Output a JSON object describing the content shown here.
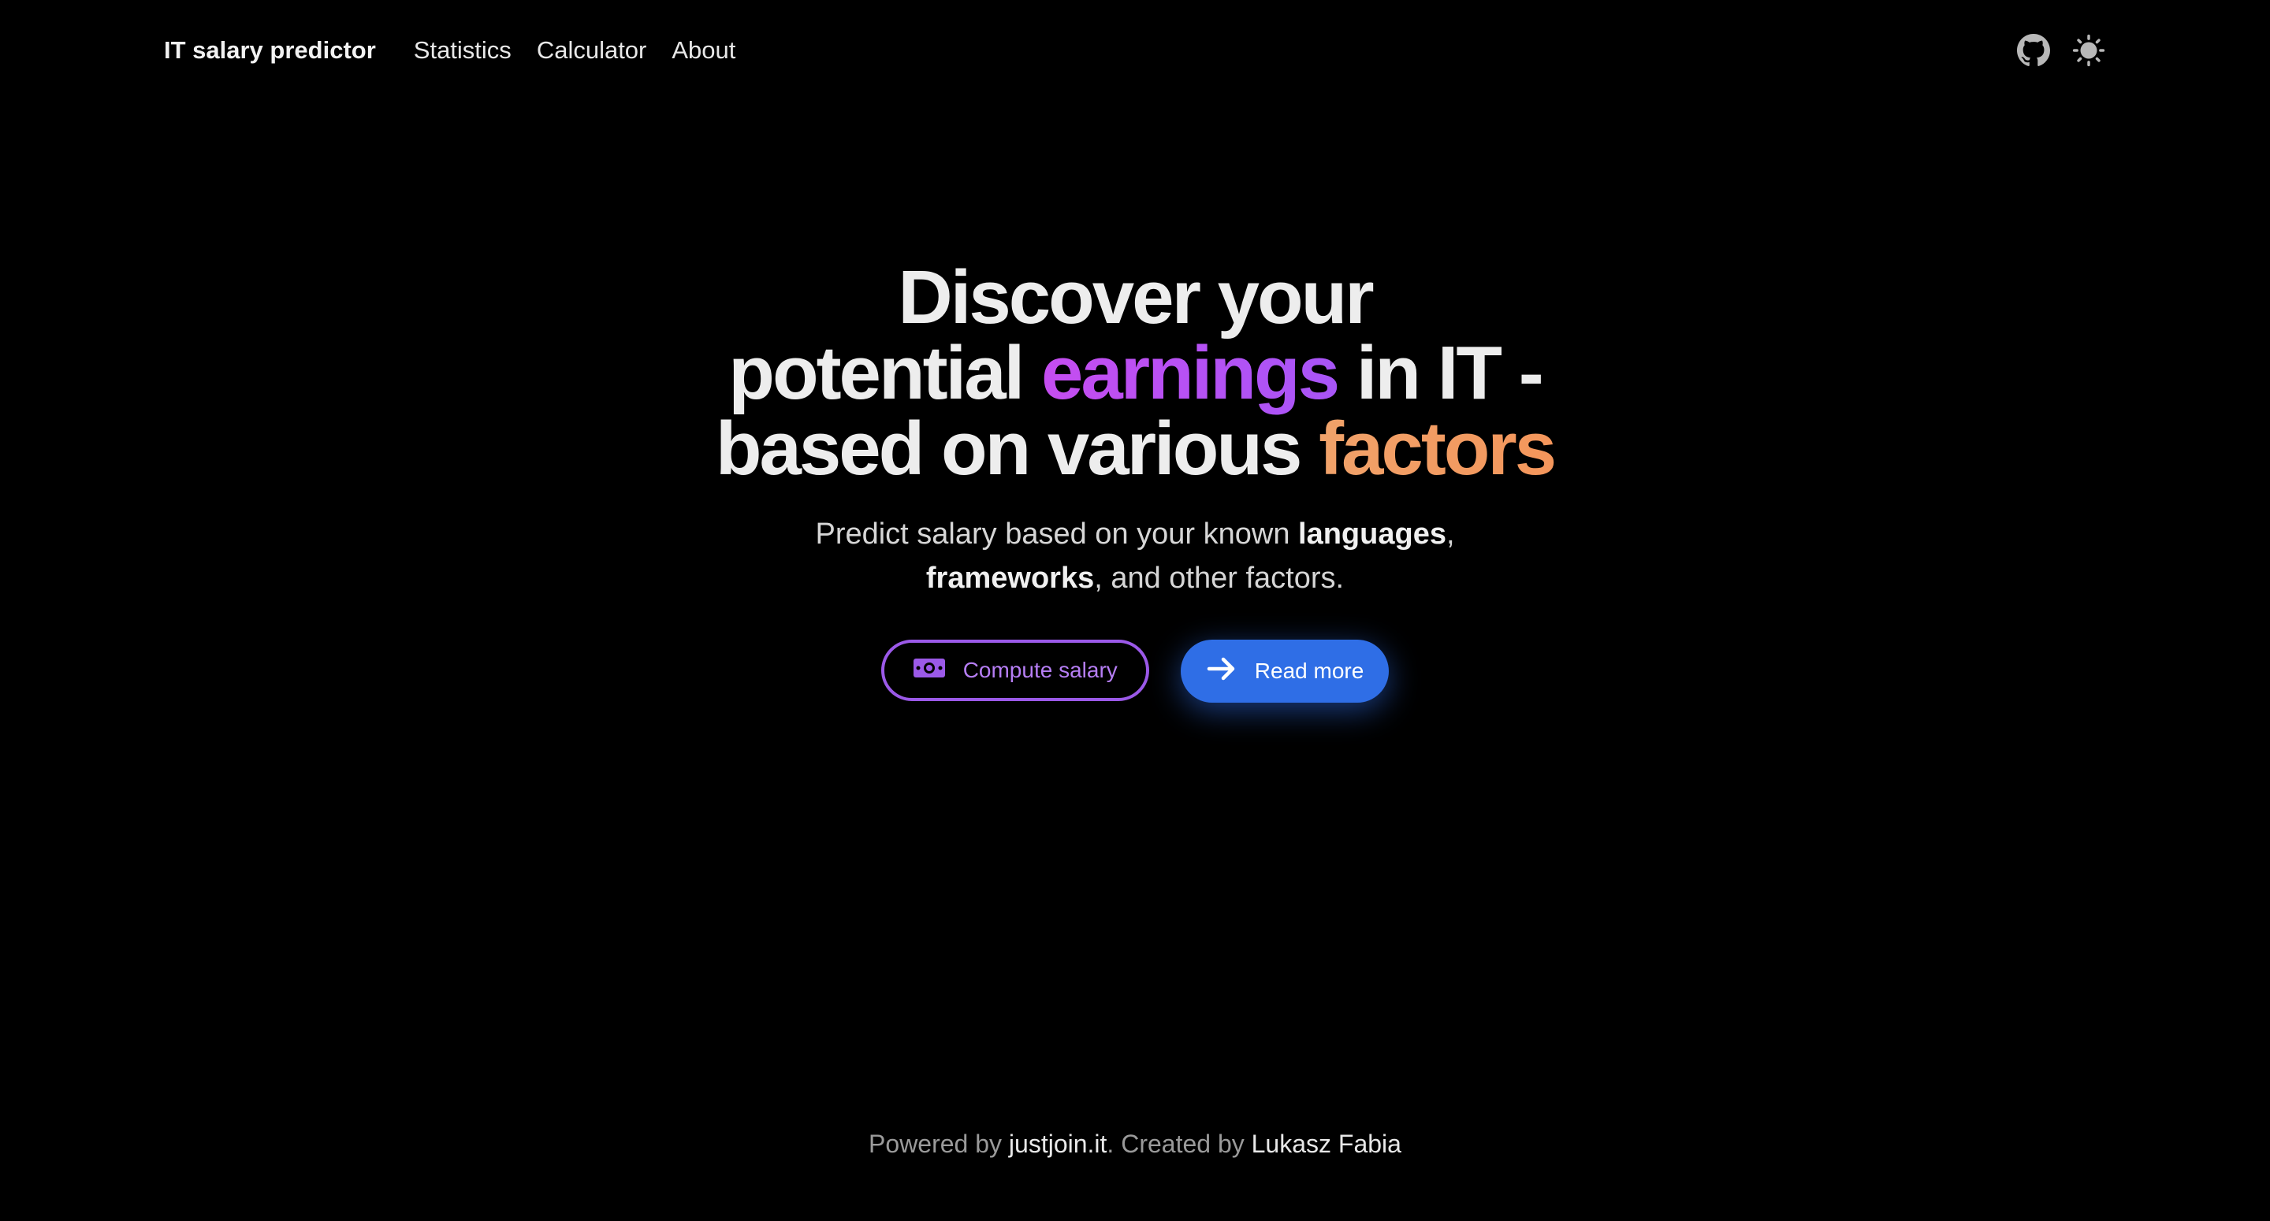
{
  "nav": {
    "brand": "IT salary predictor",
    "links": [
      "Statistics",
      "Calculator",
      "About"
    ],
    "icons": {
      "github": "github-icon",
      "theme": "sun-icon"
    }
  },
  "hero": {
    "line1": "Discover your",
    "line2_pre": "potential ",
    "line2_highlight": "earnings",
    "line2_post": " in IT -",
    "line3_pre": "based on various ",
    "line3_highlight": "factors",
    "subtitle_pre": "Predict salary based on your known ",
    "subtitle_bold1": "languages",
    "subtitle_mid": ",",
    "subtitle_bold2": "frameworks",
    "subtitle_post": ", and other factors."
  },
  "buttons": {
    "compute": "Compute salary",
    "read_more": "Read more",
    "compute_icon": "money-icon",
    "read_more_icon": "arrow-right-icon"
  },
  "footer": {
    "powered_by": "Powered by ",
    "powered_link": "justjoin.it",
    "created_by": ". Created by ",
    "author": "Lukasz Fabia"
  },
  "colors": {
    "background": "#000000",
    "accent_purple": "#b14ff2",
    "accent_orange": "#f29c63",
    "primary_blue": "#2f6ee6"
  }
}
